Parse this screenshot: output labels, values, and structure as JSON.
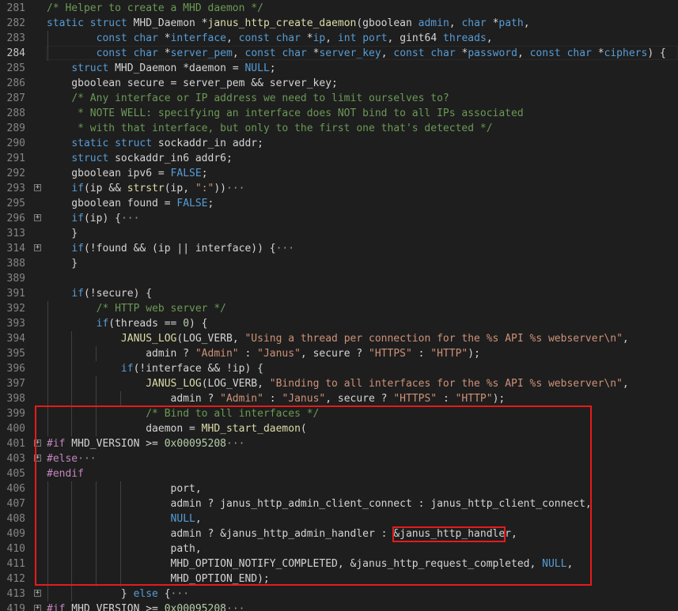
{
  "accent_colors": {
    "highlight_box": "#e51b1b",
    "background": "#1e1e1e",
    "keyword": "#569cd6",
    "comment": "#6a9955",
    "string": "#ce9178",
    "number": "#b5cea8",
    "function": "#dcdcaa",
    "preprocessor": "#c586c0"
  },
  "lines": [
    {
      "number": "281",
      "tokens": [
        [
          "cm",
          "/* Helper to create a MHD daemon */"
        ]
      ]
    },
    {
      "number": "282",
      "tokens": [
        [
          "kw",
          "static"
        ],
        [
          "tx",
          " "
        ],
        [
          "kw",
          "struct"
        ],
        [
          "tx",
          " MHD_Daemon *"
        ],
        [
          "fn",
          "janus_http_create_daemon"
        ],
        [
          "tx",
          "(gboolean "
        ],
        [
          "kw",
          "admin"
        ],
        [
          "tx",
          ", "
        ],
        [
          "kw",
          "char"
        ],
        [
          "tx",
          " *"
        ],
        [
          "kw",
          "path"
        ],
        [
          "tx",
          ","
        ]
      ]
    },
    {
      "number": "283",
      "tokens": [
        [
          "tx",
          "        "
        ],
        [
          "kw",
          "const"
        ],
        [
          "tx",
          " "
        ],
        [
          "kw",
          "char"
        ],
        [
          "tx",
          " *"
        ],
        [
          "kw",
          "interface"
        ],
        [
          "tx",
          ", "
        ],
        [
          "kw",
          "const"
        ],
        [
          "tx",
          " "
        ],
        [
          "kw",
          "char"
        ],
        [
          "tx",
          " *"
        ],
        [
          "kw",
          "ip"
        ],
        [
          "tx",
          ", "
        ],
        [
          "kw",
          "int"
        ],
        [
          "tx",
          " "
        ],
        [
          "kw",
          "port"
        ],
        [
          "tx",
          ", gint64 "
        ],
        [
          "kw",
          "threads"
        ],
        [
          "tx",
          ","
        ]
      ]
    },
    {
      "number": "284",
      "current": true,
      "tokens": [
        [
          "tx",
          "        "
        ],
        [
          "kw",
          "const"
        ],
        [
          "tx",
          " "
        ],
        [
          "kw",
          "char"
        ],
        [
          "tx",
          " *"
        ],
        [
          "kw",
          "server_pem"
        ],
        [
          "tx",
          ", "
        ],
        [
          "kw",
          "const"
        ],
        [
          "tx",
          " "
        ],
        [
          "kw",
          "char"
        ],
        [
          "tx",
          " *"
        ],
        [
          "kw",
          "server_key"
        ],
        [
          "tx",
          ", "
        ],
        [
          "kw",
          "const"
        ],
        [
          "tx",
          " "
        ],
        [
          "kw",
          "char"
        ],
        [
          "tx",
          " *"
        ],
        [
          "kw",
          "password"
        ],
        [
          "tx",
          ", "
        ],
        [
          "kw",
          "const"
        ],
        [
          "tx",
          " "
        ],
        [
          "kw",
          "char"
        ],
        [
          "tx",
          " *"
        ],
        [
          "kw",
          "ciphers"
        ],
        [
          "tx",
          ") {"
        ]
      ]
    },
    {
      "number": "285",
      "tokens": [
        [
          "tx",
          "    "
        ],
        [
          "kw",
          "struct"
        ],
        [
          "tx",
          " MHD_Daemon *daemon = "
        ],
        [
          "kw",
          "NULL"
        ],
        [
          "tx",
          ";"
        ]
      ]
    },
    {
      "number": "286",
      "tokens": [
        [
          "tx",
          "    gboolean secure = server_pem && server_key;"
        ]
      ]
    },
    {
      "number": "287",
      "tokens": [
        [
          "tx",
          "    "
        ],
        [
          "cm",
          "/* Any interface or IP address we need to limit ourselves to?"
        ]
      ]
    },
    {
      "number": "288",
      "tokens": [
        [
          "tx",
          "    "
        ],
        [
          "cm",
          " * NOTE WELL: specifying an interface does NOT bind to all IPs associated"
        ]
      ]
    },
    {
      "number": "289",
      "tokens": [
        [
          "tx",
          "    "
        ],
        [
          "cm",
          " * with that interface, but only to the first one that's detected */"
        ]
      ]
    },
    {
      "number": "290",
      "tokens": [
        [
          "tx",
          "    "
        ],
        [
          "kw",
          "static"
        ],
        [
          "tx",
          " "
        ],
        [
          "kw",
          "struct"
        ],
        [
          "tx",
          " sockaddr_in addr;"
        ]
      ]
    },
    {
      "number": "291",
      "tokens": [
        [
          "tx",
          "    "
        ],
        [
          "kw",
          "struct"
        ],
        [
          "tx",
          " sockaddr_in6 addr6;"
        ]
      ]
    },
    {
      "number": "292",
      "tokens": [
        [
          "tx",
          "    gboolean ipv6 = "
        ],
        [
          "kw",
          "FALSE"
        ],
        [
          "tx",
          ";"
        ]
      ]
    },
    {
      "number": "293",
      "fold": "+",
      "tokens": [
        [
          "tx",
          "    "
        ],
        [
          "kw",
          "if"
        ],
        [
          "tx",
          "(ip && "
        ],
        [
          "fn",
          "strstr"
        ],
        [
          "tx",
          "(ip, "
        ],
        [
          "str",
          "\":\""
        ],
        [
          "tx",
          "))"
        ],
        [
          "el",
          "···"
        ]
      ]
    },
    {
      "number": "295",
      "tokens": [
        [
          "tx",
          "    gboolean found = "
        ],
        [
          "kw",
          "FALSE"
        ],
        [
          "tx",
          ";"
        ]
      ]
    },
    {
      "number": "296",
      "fold": "+",
      "tokens": [
        [
          "tx",
          "    "
        ],
        [
          "kw",
          "if"
        ],
        [
          "tx",
          "(ip) {"
        ],
        [
          "el",
          "···"
        ]
      ]
    },
    {
      "number": "313",
      "tokens": [
        [
          "tx",
          "    }"
        ]
      ]
    },
    {
      "number": "314",
      "fold": "+",
      "tokens": [
        [
          "tx",
          "    "
        ],
        [
          "kw",
          "if"
        ],
        [
          "tx",
          "(!found && (ip || interface)) {"
        ],
        [
          "el",
          "···"
        ]
      ]
    },
    {
      "number": "388",
      "tokens": [
        [
          "tx",
          "    }"
        ]
      ]
    },
    {
      "number": "389",
      "tokens": []
    },
    {
      "number": "391",
      "tokens": [
        [
          "tx",
          "    "
        ],
        [
          "kw",
          "if"
        ],
        [
          "tx",
          "(!secure) {"
        ]
      ]
    },
    {
      "number": "392",
      "tokens": [
        [
          "tx",
          "        "
        ],
        [
          "cm",
          "/* HTTP web server */"
        ]
      ]
    },
    {
      "number": "393",
      "tokens": [
        [
          "tx",
          "        "
        ],
        [
          "kw",
          "if"
        ],
        [
          "tx",
          "(threads == "
        ],
        [
          "num",
          "0"
        ],
        [
          "tx",
          ") {"
        ]
      ]
    },
    {
      "number": "394",
      "tokens": [
        [
          "tx",
          "            "
        ],
        [
          "fn",
          "JANUS_LOG"
        ],
        [
          "tx",
          "(LOG_VERB, "
        ],
        [
          "str",
          "\"Using a thread per connection for the %s API %s webserver\\n\""
        ],
        [
          "tx",
          ","
        ]
      ]
    },
    {
      "number": "395",
      "tokens": [
        [
          "tx",
          "                admin ? "
        ],
        [
          "str",
          "\"Admin\""
        ],
        [
          "tx",
          " : "
        ],
        [
          "str",
          "\"Janus\""
        ],
        [
          "tx",
          ", secure ? "
        ],
        [
          "str",
          "\"HTTPS\""
        ],
        [
          "tx",
          " : "
        ],
        [
          "str",
          "\"HTTP\""
        ],
        [
          "tx",
          ");"
        ]
      ]
    },
    {
      "number": "396",
      "tokens": [
        [
          "tx",
          "            "
        ],
        [
          "kw",
          "if"
        ],
        [
          "tx",
          "(!interface && !ip) {"
        ]
      ]
    },
    {
      "number": "397",
      "tokens": [
        [
          "tx",
          "                "
        ],
        [
          "fn",
          "JANUS_LOG"
        ],
        [
          "tx",
          "(LOG_VERB, "
        ],
        [
          "str",
          "\"Binding to all interfaces for the %s API %s webserver\\n\""
        ],
        [
          "tx",
          ","
        ]
      ]
    },
    {
      "number": "398",
      "tokens": [
        [
          "tx",
          "                    admin ? "
        ],
        [
          "str",
          "\"Admin\""
        ],
        [
          "tx",
          " : "
        ],
        [
          "str",
          "\"Janus\""
        ],
        [
          "tx",
          ", secure ? "
        ],
        [
          "str",
          "\"HTTPS\""
        ],
        [
          "tx",
          " : "
        ],
        [
          "str",
          "\"HTTP\""
        ],
        [
          "tx",
          ");"
        ]
      ]
    },
    {
      "number": "399",
      "tokens": [
        [
          "tx",
          "                "
        ],
        [
          "cm",
          "/* Bind to all interfaces */"
        ]
      ]
    },
    {
      "number": "400",
      "tokens": [
        [
          "tx",
          "                daemon = "
        ],
        [
          "fn",
          "MHD_start_daemon"
        ],
        [
          "tx",
          "("
        ]
      ]
    },
    {
      "number": "401",
      "fold": "+",
      "tokens": [
        [
          "pp",
          "#if"
        ],
        [
          "tx",
          " MHD_VERSION >= "
        ],
        [
          "num",
          "0x00095208"
        ],
        [
          "el",
          "···"
        ]
      ]
    },
    {
      "number": "403",
      "fold": "+",
      "tokens": [
        [
          "pp",
          "#else"
        ],
        [
          "el",
          "···"
        ]
      ]
    },
    {
      "number": "405",
      "tokens": [
        [
          "pp",
          "#endif"
        ]
      ]
    },
    {
      "number": "406",
      "tokens": [
        [
          "tx",
          "                    port,"
        ]
      ]
    },
    {
      "number": "407",
      "tokens": [
        [
          "tx",
          "                    admin ? janus_http_admin_client_connect : janus_http_client_connect,"
        ]
      ]
    },
    {
      "number": "408",
      "tokens": [
        [
          "tx",
          "                    "
        ],
        [
          "kw",
          "NULL"
        ],
        [
          "tx",
          ","
        ]
      ]
    },
    {
      "number": "409",
      "tokens": [
        [
          "tx",
          "                    admin ? &janus_http_admin_handler : &janus_http_handler,"
        ]
      ]
    },
    {
      "number": "410",
      "tokens": [
        [
          "tx",
          "                    path,"
        ]
      ]
    },
    {
      "number": "411",
      "tokens": [
        [
          "tx",
          "                    MHD_OPTION_NOTIFY_COMPLETED, &janus_http_request_completed, "
        ],
        [
          "kw",
          "NULL"
        ],
        [
          "tx",
          ","
        ]
      ]
    },
    {
      "number": "412",
      "tokens": [
        [
          "tx",
          "                    MHD_OPTION_END);"
        ]
      ]
    },
    {
      "number": "413",
      "fold": "+",
      "tokens": [
        [
          "tx",
          "            } "
        ],
        [
          "kw",
          "else"
        ],
        [
          "tx",
          " {"
        ],
        [
          "el",
          "···"
        ]
      ]
    },
    {
      "number": "419",
      "fold": "+",
      "tokens": [
        [
          "pp",
          "#if"
        ],
        [
          "tx",
          " MHD_VERSION >= "
        ],
        [
          "num",
          "0x00095208"
        ],
        [
          "el",
          "···"
        ]
      ]
    }
  ]
}
